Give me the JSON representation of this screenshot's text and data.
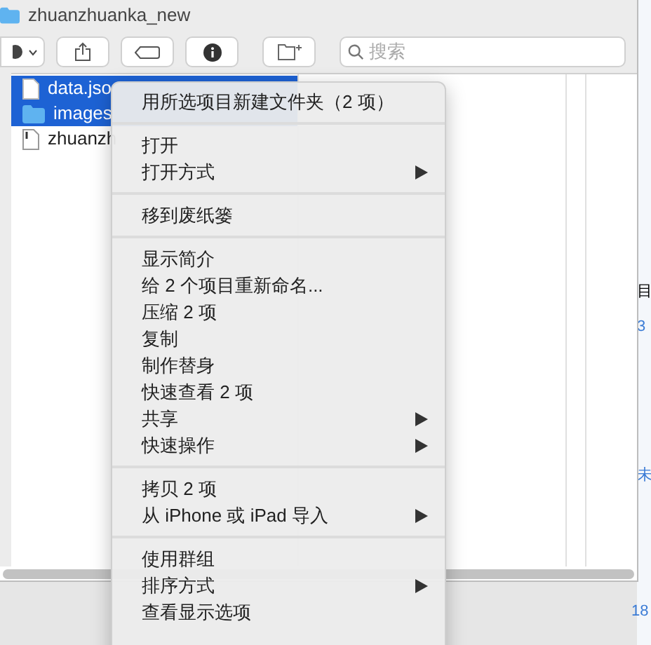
{
  "window": {
    "title": "zhuanzhuanka_new"
  },
  "search": {
    "placeholder": "搜索"
  },
  "files": [
    {
      "name": "data.jso",
      "kind": "file",
      "selected": true
    },
    {
      "name": "images",
      "kind": "folder",
      "selected": true
    },
    {
      "name": "zhuanzh",
      "kind": "exec",
      "selected": false
    }
  ],
  "background_fragments": [
    "目",
    "3",
    "未",
    "18"
  ],
  "menu": {
    "groups": [
      [
        {
          "label": "用所选项目新建文件夹（2 项）",
          "submenu": false
        }
      ],
      [
        {
          "label": "打开",
          "submenu": false
        },
        {
          "label": "打开方式",
          "submenu": true
        }
      ],
      [
        {
          "label": "移到废纸篓",
          "submenu": false
        }
      ],
      [
        {
          "label": "显示简介",
          "submenu": false
        },
        {
          "label": "给 2 个项目重新命名...",
          "submenu": false
        },
        {
          "label": "压缩 2 项",
          "submenu": false
        },
        {
          "label": "复制",
          "submenu": false
        },
        {
          "label": "制作替身",
          "submenu": false
        },
        {
          "label": "快速查看 2 项",
          "submenu": false
        },
        {
          "label": "共享",
          "submenu": true
        },
        {
          "label": "快速操作",
          "submenu": true
        }
      ],
      [
        {
          "label": "拷贝 2 项",
          "submenu": false
        },
        {
          "label": "从 iPhone 或 iPad 导入",
          "submenu": true
        }
      ],
      [
        {
          "label": "使用群组",
          "submenu": false
        },
        {
          "label": "排序方式",
          "submenu": true
        },
        {
          "label": "查看显示选项",
          "submenu": false
        }
      ]
    ]
  }
}
